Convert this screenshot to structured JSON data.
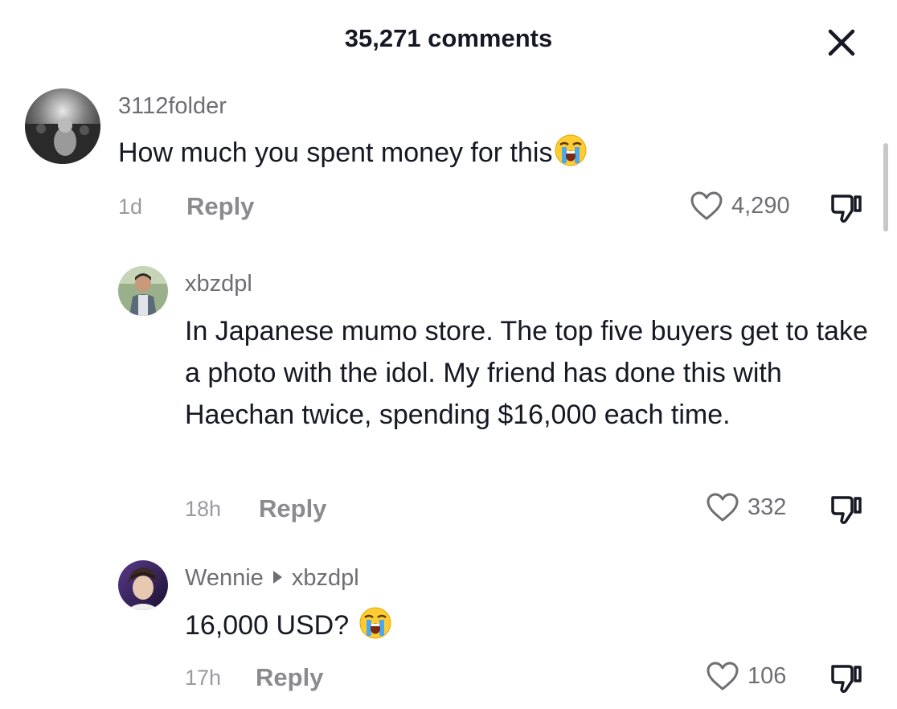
{
  "header": {
    "title": "35,271 comments",
    "close_icon": "close-icon"
  },
  "comments": [
    {
      "username": "3112folder",
      "text": "How much you spent money for this",
      "emoji": "loudly-crying-face",
      "time": "1d",
      "reply_label": "Reply",
      "likes": "4,290"
    },
    {
      "username": "xbzdpl",
      "text": "In Japanese mumo store. The top five buyers get to take a photo with the idol. My friend has done this with Haechan twice, spending $16,000 each time.",
      "time": "18h",
      "reply_label": "Reply",
      "likes": "332"
    },
    {
      "username": "Wennie",
      "reply_to": "xbzdpl",
      "text": "16,000 USD?",
      "emoji": "loudly-crying-face",
      "time": "17h",
      "reply_label": "Reply",
      "likes": "106"
    }
  ],
  "colors": {
    "text": "#161823",
    "secondary": "#6e6e73",
    "muted": "#9a9a9f"
  }
}
